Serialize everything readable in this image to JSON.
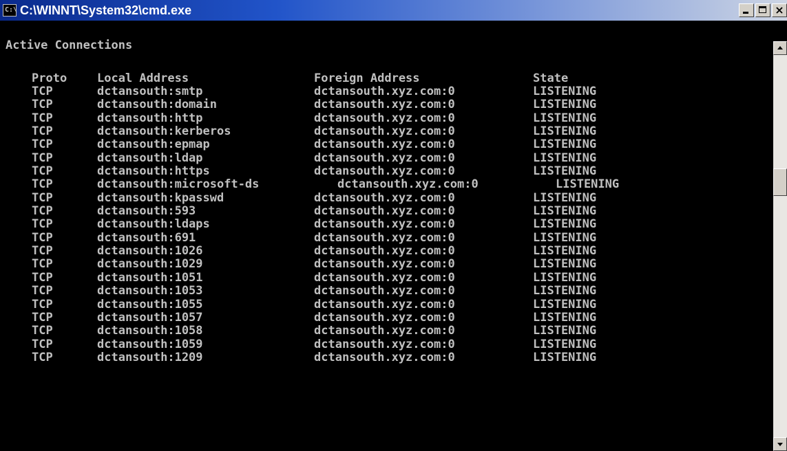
{
  "window": {
    "title": "C:\\WINNT\\System32\\cmd.exe",
    "icon_label": "C:\\",
    "close_glyph": "×"
  },
  "console": {
    "heading": "Active Connections",
    "headers": {
      "proto": "Proto",
      "local": "Local Address",
      "foreign": "Foreign Address",
      "state": "State"
    },
    "rows": [
      {
        "proto": "TCP",
        "local": "dctansouth:smtp",
        "foreign": "dctansouth.xyz.com:0",
        "state": "LISTENING"
      },
      {
        "proto": "TCP",
        "local": "dctansouth:domain",
        "foreign": "dctansouth.xyz.com:0",
        "state": "LISTENING"
      },
      {
        "proto": "TCP",
        "local": "dctansouth:http",
        "foreign": "dctansouth.xyz.com:0",
        "state": "LISTENING"
      },
      {
        "proto": "TCP",
        "local": "dctansouth:kerberos",
        "foreign": "dctansouth.xyz.com:0",
        "state": "LISTENING"
      },
      {
        "proto": "TCP",
        "local": "dctansouth:epmap",
        "foreign": "dctansouth.xyz.com:0",
        "state": "LISTENING"
      },
      {
        "proto": "TCP",
        "local": "dctansouth:ldap",
        "foreign": "dctansouth.xyz.com:0",
        "state": "LISTENING"
      },
      {
        "proto": "TCP",
        "local": "dctansouth:https",
        "foreign": "dctansouth.xyz.com:0",
        "state": "LISTENING"
      },
      {
        "proto": "TCP",
        "local": "dctansouth:microsoft-ds",
        "foreign": "dctansouth.xyz.com:0",
        "state": "LISTENING"
      },
      {
        "proto": "TCP",
        "local": "dctansouth:kpasswd",
        "foreign": "dctansouth.xyz.com:0",
        "state": "LISTENING"
      },
      {
        "proto": "TCP",
        "local": "dctansouth:593",
        "foreign": "dctansouth.xyz.com:0",
        "state": "LISTENING"
      },
      {
        "proto": "TCP",
        "local": "dctansouth:ldaps",
        "foreign": "dctansouth.xyz.com:0",
        "state": "LISTENING"
      },
      {
        "proto": "TCP",
        "local": "dctansouth:691",
        "foreign": "dctansouth.xyz.com:0",
        "state": "LISTENING"
      },
      {
        "proto": "TCP",
        "local": "dctansouth:1026",
        "foreign": "dctansouth.xyz.com:0",
        "state": "LISTENING"
      },
      {
        "proto": "TCP",
        "local": "dctansouth:1029",
        "foreign": "dctansouth.xyz.com:0",
        "state": "LISTENING"
      },
      {
        "proto": "TCP",
        "local": "dctansouth:1051",
        "foreign": "dctansouth.xyz.com:0",
        "state": "LISTENING"
      },
      {
        "proto": "TCP",
        "local": "dctansouth:1053",
        "foreign": "dctansouth.xyz.com:0",
        "state": "LISTENING"
      },
      {
        "proto": "TCP",
        "local": "dctansouth:1055",
        "foreign": "dctansouth.xyz.com:0",
        "state": "LISTENING"
      },
      {
        "proto": "TCP",
        "local": "dctansouth:1057",
        "foreign": "dctansouth.xyz.com:0",
        "state": "LISTENING"
      },
      {
        "proto": "TCP",
        "local": "dctansouth:1058",
        "foreign": "dctansouth.xyz.com:0",
        "state": "LISTENING"
      },
      {
        "proto": "TCP",
        "local": "dctansouth:1059",
        "foreign": "dctansouth.xyz.com:0",
        "state": "LISTENING"
      },
      {
        "proto": "TCP",
        "local": "dctansouth:1209",
        "foreign": "dctansouth.xyz.com:0",
        "state": "LISTENING"
      }
    ]
  },
  "colors": {
    "console_bg": "#000000",
    "console_text": "#c0c0c0",
    "titlebar_start": "#0a2a8c",
    "titlebar_end": "#cdd5e4"
  }
}
